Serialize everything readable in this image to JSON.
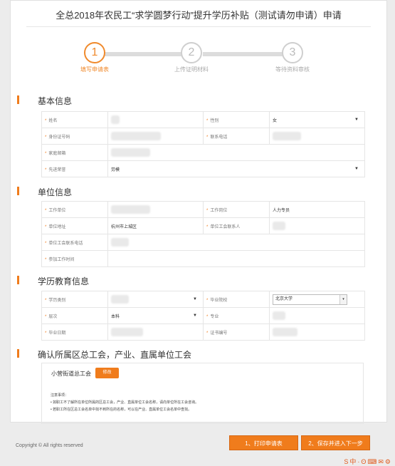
{
  "page": {
    "title": "全总2018年农民工“求学圆梦行动”提升学历补贴（测试请勿申请）申请"
  },
  "steps": [
    {
      "number": "1",
      "label": "填写申请表",
      "active": true
    },
    {
      "number": "2",
      "label": "上传证明材料",
      "active": false
    },
    {
      "number": "3",
      "label": "等待资料审核",
      "active": false
    }
  ],
  "sections": {
    "basic": "基本信息",
    "unit": "单位信息",
    "education": "学历教育信息",
    "confirm": "确认所属区总工会，产业、直属单位工会"
  },
  "basic": {
    "name_label": "姓名",
    "gender_label": "性别",
    "gender_value": "女",
    "id_label": "身份证号码",
    "contact_label": "联系电话",
    "address_label": "家庭邮箱",
    "type_label": "先进荣誉",
    "type_value": "劳模"
  },
  "unit": {
    "company_label": "工作单位",
    "position_label": "工作岗位",
    "position_value": "人力专员",
    "address_label": "单位地址",
    "address_value": "杭州市上城区",
    "union_contact_label": "单位工会联系人",
    "union_phone_label": "单位工会联系电话",
    "start_date_label": "参加工作时间"
  },
  "education": {
    "category_label": "学历类别",
    "school_label": "毕业院校",
    "school_value": "北京大学",
    "level_label": "层次",
    "level_value": "本科",
    "major_label": "专业",
    "grad_date_label": "毕业日期",
    "cert_label": "证书编号"
  },
  "confirm": {
    "org_name": "小营街道总工会",
    "modify_label": "修改",
    "notes_title": "注意事项：",
    "note_1": "• 如职工不了解所在单位所属的区总工会，产业、直属单位工会名称，请向单位所在工会咨询。",
    "note_2": "• 若职工所在区总工会名单中找不到所在的名称，可以在产业、直属单位工会名单中查找。"
  },
  "footer": {
    "copyright": "Copyright © All rights reserved",
    "print_button": "1、打印申请表",
    "save_button": "2、保存并进入下一步"
  },
  "colors": {
    "accent": "#f07c1c",
    "step_inactive": "#cfcfcf"
  }
}
